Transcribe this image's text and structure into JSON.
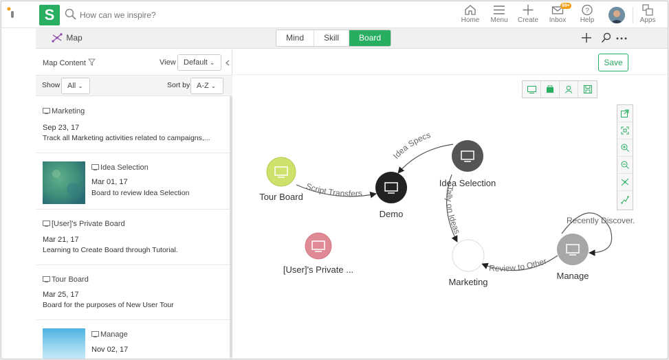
{
  "app": {
    "logo_letter": "S",
    "search_placeholder": "How can we inspire?"
  },
  "nav": [
    {
      "id": "home",
      "label": "Home"
    },
    {
      "id": "menu",
      "label": "Menu"
    },
    {
      "id": "create",
      "label": "Create"
    },
    {
      "id": "inbox",
      "label": "Inbox",
      "badge": "99+"
    },
    {
      "id": "help",
      "label": "Help"
    },
    {
      "id": "apps",
      "label": "Apps"
    }
  ],
  "subbar": {
    "map_label": "Map",
    "tabs": [
      "Mind",
      "Skill",
      "Board"
    ],
    "active_tab": "Board"
  },
  "panel": {
    "title": "Map Content",
    "view_label": "View",
    "view_value": "Default",
    "show_label": "Show",
    "show_value": "All",
    "sort_label": "Sort by",
    "sort_value": "A-Z",
    "items": [
      {
        "title": "Marketing",
        "date": "Sep 23, 17",
        "desc": "Track all Marketing activities related to campaigns,...",
        "thumb": false
      },
      {
        "title": "Idea Selection",
        "date": "Mar 01, 17",
        "desc": "Board to review Idea Selection",
        "thumb": true,
        "thumb_color": "#3d8f7a"
      },
      {
        "title": "[User]'s Private Board",
        "date": "Mar 21, 17",
        "desc": "Learning to Create Board through Tutorial.",
        "thumb": false
      },
      {
        "title": "Tour Board",
        "date": "Mar 25, 17",
        "desc": "Board for the purposes of New User Tour",
        "thumb": false
      },
      {
        "title": "Manage",
        "date": "Nov 02, 17",
        "desc": "",
        "thumb": true,
        "thumb_color": "#7ec8ea"
      }
    ]
  },
  "canvas": {
    "save_label": "Save",
    "nodes": [
      {
        "id": "tour",
        "label": "Tour Board",
        "color": "#cfe06b"
      },
      {
        "id": "demo",
        "label": "Demo",
        "color": "#222222"
      },
      {
        "id": "idea",
        "label": "Idea Selection",
        "color": "#555555"
      },
      {
        "id": "private",
        "label": "[User]'s Private ...",
        "color": "#e08a96"
      },
      {
        "id": "marketing",
        "label": "Marketing",
        "color": "#ffffff"
      },
      {
        "id": "manage",
        "label": "Manage",
        "color": "#a7a7a7"
      }
    ],
    "edges": [
      {
        "label": "Script Transfers"
      },
      {
        "label": "Idea Specs"
      },
      {
        "label": "Tally on Ideas"
      },
      {
        "label": "Review to Other"
      },
      {
        "label": "Recently Discover."
      }
    ]
  },
  "colors": {
    "accent": "#27ae60",
    "badge": "#f39c12"
  }
}
